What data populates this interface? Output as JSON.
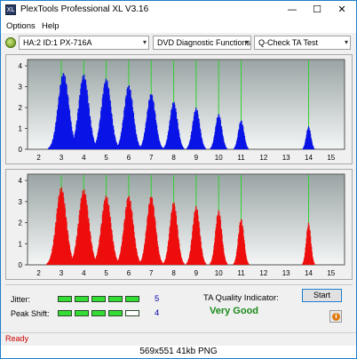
{
  "window": {
    "title": "PlexTools Professional XL V3.16",
    "icon_text": "XL",
    "minimize_glyph": "—",
    "maximize_glyph": "☐",
    "close_glyph": "✕"
  },
  "menu": {
    "items": [
      "Options",
      "Help"
    ]
  },
  "toolbar": {
    "drive": "HA:2 ID:1  PX-716A",
    "function": "DVD Diagnostic Functions",
    "test": "Q-Check  TA Test",
    "dropdown_glyph": "▾"
  },
  "charts": {
    "upper_color": "#0a14e6",
    "lower_color": "#ee0e0e",
    "marker_color": "#2fd02f",
    "x_ticks": [
      "2",
      "3",
      "4",
      "5",
      "6",
      "7",
      "8",
      "9",
      "10",
      "11",
      "12",
      "13",
      "14",
      "15"
    ],
    "y_ticks": [
      "0",
      "1",
      "2",
      "3",
      "4"
    ]
  },
  "chart_data": [
    {
      "type": "bar",
      "name": "upper",
      "x_range": [
        1.5,
        15.6
      ],
      "ylim": [
        0,
        4.3
      ],
      "marker_lines_x": [
        3,
        4,
        5,
        6,
        7,
        8,
        9,
        10,
        11,
        14
      ],
      "peaks": [
        {
          "center": 3.1,
          "height": 3.7,
          "width": 0.42
        },
        {
          "center": 4.0,
          "height": 3.6,
          "width": 0.4
        },
        {
          "center": 5.0,
          "height": 3.4,
          "width": 0.38
        },
        {
          "center": 6.0,
          "height": 3.1,
          "width": 0.36
        },
        {
          "center": 7.0,
          "height": 2.7,
          "width": 0.34
        },
        {
          "center": 8.0,
          "height": 2.3,
          "width": 0.3
        },
        {
          "center": 9.0,
          "height": 2.0,
          "width": 0.28
        },
        {
          "center": 10.0,
          "height": 1.7,
          "width": 0.25
        },
        {
          "center": 11.0,
          "height": 1.4,
          "width": 0.22
        },
        {
          "center": 14.0,
          "height": 1.1,
          "width": 0.18
        }
      ]
    },
    {
      "type": "bar",
      "name": "lower",
      "x_range": [
        1.5,
        15.6
      ],
      "ylim": [
        0,
        4.3
      ],
      "marker_lines_x": [
        3,
        4,
        5,
        6,
        7,
        8,
        9,
        10,
        11,
        14
      ],
      "peaks": [
        {
          "center": 3.0,
          "height": 3.7,
          "width": 0.4
        },
        {
          "center": 4.0,
          "height": 3.6,
          "width": 0.4
        },
        {
          "center": 5.0,
          "height": 3.3,
          "width": 0.38
        },
        {
          "center": 6.0,
          "height": 3.3,
          "width": 0.36
        },
        {
          "center": 7.0,
          "height": 3.3,
          "width": 0.34
        },
        {
          "center": 8.0,
          "height": 3.0,
          "width": 0.3
        },
        {
          "center": 9.0,
          "height": 2.8,
          "width": 0.28
        },
        {
          "center": 10.0,
          "height": 2.6,
          "width": 0.25
        },
        {
          "center": 11.0,
          "height": 2.2,
          "width": 0.22
        },
        {
          "center": 14.0,
          "height": 2.0,
          "width": 0.18
        }
      ]
    }
  ],
  "metrics": {
    "jitter": {
      "label": "Jitter:",
      "value": "5",
      "filled": 5,
      "total": 5
    },
    "peak_shift": {
      "label": "Peak Shift:",
      "value": "4",
      "filled": 4,
      "total": 5
    },
    "meter_on_color": "#33dd33",
    "meter_off_color": "#ffffff"
  },
  "ta_quality": {
    "label": "TA Quality Indicator:",
    "value": "Very Good"
  },
  "buttons": {
    "start": "Start",
    "info_glyph": "i"
  },
  "status": {
    "text": "Ready"
  },
  "caption": {
    "text": "569x551  41kb  PNG"
  }
}
